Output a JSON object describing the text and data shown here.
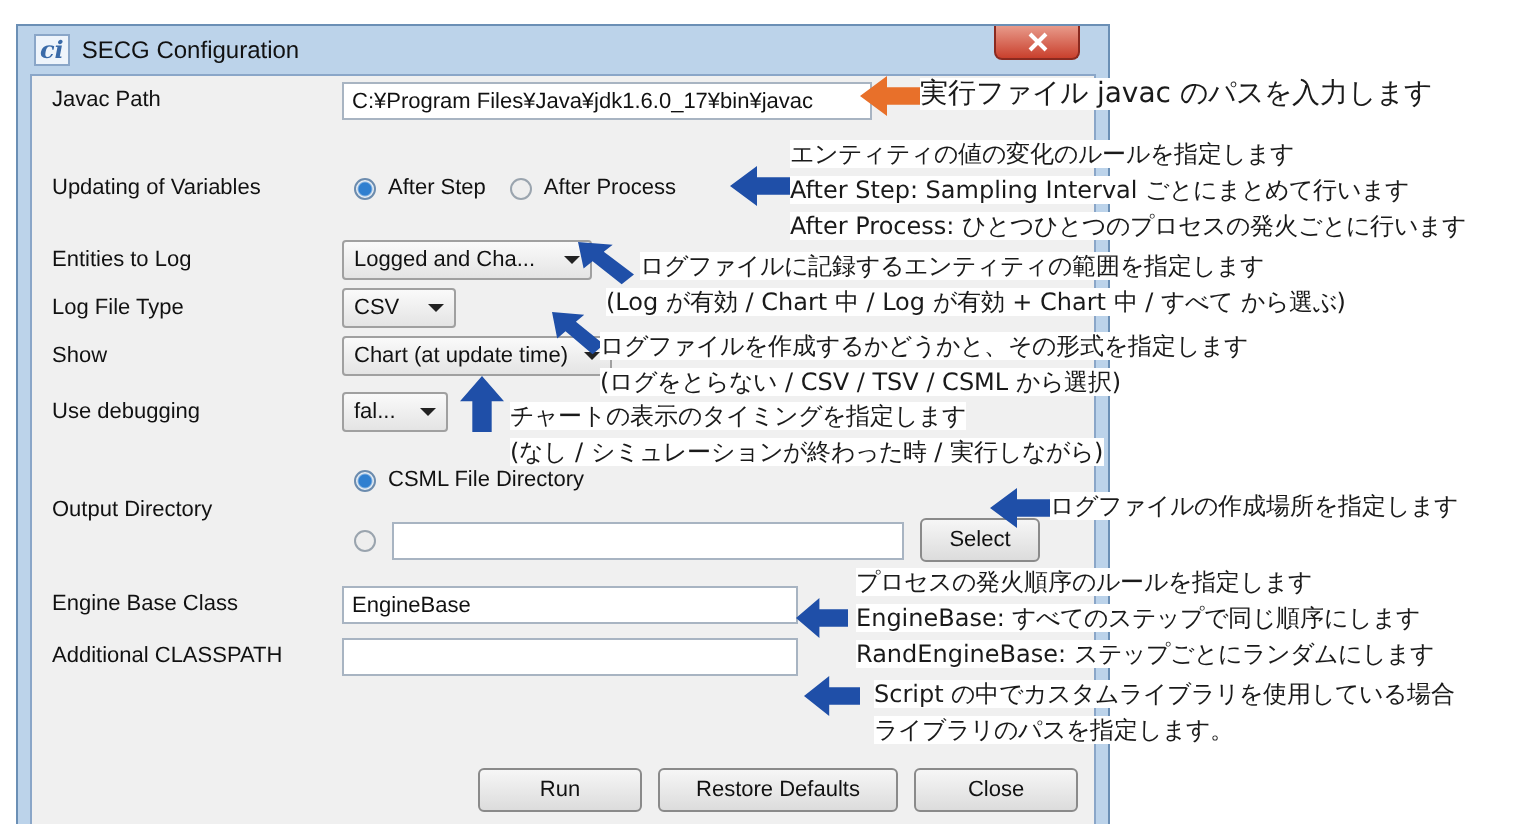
{
  "window": {
    "icon": "ci",
    "title": "SECG Configuration"
  },
  "rows": [
    {
      "kind": "text",
      "label": "Javac Path",
      "value": "C:¥Program Files¥Java¥jdk1.6.0_17¥bin¥javac"
    },
    {
      "kind": "radio",
      "label": "Updating of Variables",
      "options": [
        {
          "label": "After Step",
          "selected": true
        },
        {
          "label": "After Process",
          "selected": false
        }
      ]
    },
    {
      "kind": "dropdown",
      "label": "Entities to Log",
      "value": "Logged and Cha..."
    },
    {
      "kind": "dropdown",
      "label": "Log File Type",
      "value": "CSV"
    },
    {
      "kind": "dropdown",
      "label": "Show",
      "value": "Chart (at update time)"
    },
    {
      "kind": "dropdown",
      "label": "Use debugging",
      "value": "fal..."
    },
    {
      "kind": "directory",
      "label": "Output Directory",
      "options": [
        {
          "label": "CSML File Directory",
          "selected": true
        },
        {
          "selected": false
        }
      ],
      "button": "Select"
    },
    {
      "kind": "text",
      "label": "Engine Base Class",
      "value": "EngineBase"
    },
    {
      "kind": "text",
      "label": "Additional CLASSPATH"
    }
  ],
  "buttons": [
    "Run",
    "Restore Defaults",
    "Close"
  ],
  "callouts": [
    {
      "kind": "left",
      "color": "#e8702a",
      "lines": [
        "実行ファイル javac のパスを入力します"
      ]
    },
    {
      "kind": "left",
      "color": "#1f4fa8",
      "lines": [
        "エンティティの値の変化のルールを指定します",
        "After Step: Sampling Interval ごとにまとめて行います",
        "After Process: ひとつひとつのプロセスの発火ごとに行います"
      ]
    },
    {
      "kind": "up-left",
      "color": "#1f4fa8",
      "lines": [
        "ログファイルに記録するエンティティの範囲を指定します",
        "(Log が有効 / Chart 中 / Log が有効 + Chart 中 / すべて から選ぶ)"
      ]
    },
    {
      "kind": "up-left",
      "color": "#1f4fa8",
      "lines": [
        "ログファイルを作成するかどうかと、その形式を指定します",
        "(ログをとらない / CSV / TSV / CSML から選択)"
      ]
    },
    {
      "kind": "up",
      "color": "#1f4fa8",
      "lines": [
        "チャートの表示のタイミングを指定します",
        "(なし / シミュレーションが終わった時 / 実行しながら)"
      ]
    },
    {
      "kind": "left",
      "color": "#1f4fa8",
      "lines": [
        "ログファイルの作成場所を指定します"
      ]
    },
    {
      "kind": "left",
      "color": "#1f4fa8",
      "lines": [
        "プロセスの発火順序のルールを指定します",
        "EngineBase: すべてのステップで同じ順序にします",
        "RandEngineBase: ステップごとにランダムにします"
      ]
    },
    {
      "kind": "left",
      "color": "#1f4fa8",
      "lines": [
        "Script の中でカスタムライブラリを使用している場合",
        "ライブラリのパスを指定します。"
      ]
    }
  ]
}
